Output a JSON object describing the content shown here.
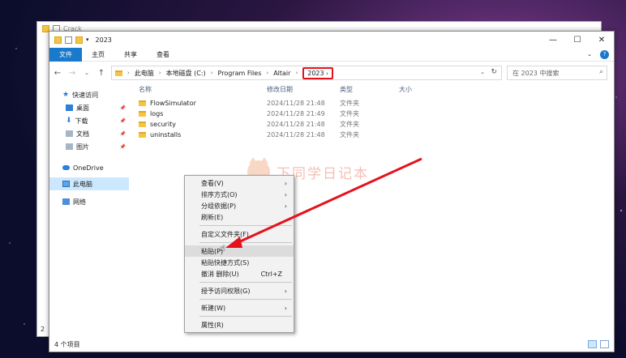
{
  "back_window": {
    "title": "Crack",
    "footer_text": "2"
  },
  "window": {
    "title": "2023",
    "minimize": "—",
    "maximize": "☐",
    "close": "✕"
  },
  "ribbon": {
    "tabs": [
      "文件",
      "主页",
      "共享",
      "查看"
    ],
    "active_tab": "文件"
  },
  "address": {
    "crumbs": [
      "此电脑",
      "本地磁盘 (C:)",
      "Program Files",
      "Altair",
      "2023"
    ],
    "current": "2023",
    "highlight_color": "#e5121c"
  },
  "search": {
    "placeholder": "在 2023 中搜索"
  },
  "nav_pane": {
    "quick_access": "快速访问",
    "pinned": [
      "桌面",
      "下载",
      "文档",
      "图片"
    ],
    "onedrive": "OneDrive",
    "this_pc": "此电脑",
    "network": "网络"
  },
  "columns": {
    "name": "名称",
    "date": "修改日期",
    "type": "类型",
    "size": "大小"
  },
  "files": [
    {
      "name": "FlowSimulator",
      "date": "2024/11/28 21:48",
      "type": "文件夹"
    },
    {
      "name": "logs",
      "date": "2024/11/28 21:49",
      "type": "文件夹"
    },
    {
      "name": "security",
      "date": "2024/11/28 21:48",
      "type": "文件夹"
    },
    {
      "name": "uninstalls",
      "date": "2024/11/28 21:48",
      "type": "文件夹"
    }
  ],
  "status": {
    "item_count": "4 个项目"
  },
  "context_menu": {
    "view": "查看(V)",
    "sort": "排序方式(O)",
    "group": "分组依据(P)",
    "refresh": "刷新(E)",
    "customize": "自定义文件夹(F)...",
    "paste": "粘贴(P)",
    "paste_shortcut": "粘贴快捷方式(S)",
    "undo_delete": "撤消 删除(U)",
    "undo_shortcut": "Ctrl+Z",
    "grant_access": "授予访问权限(G)",
    "new": "新建(W)",
    "properties": "属性(R)"
  },
  "watermark": {
    "text": "下同学日记本"
  },
  "annotation_arrow_color": "#e5121c"
}
